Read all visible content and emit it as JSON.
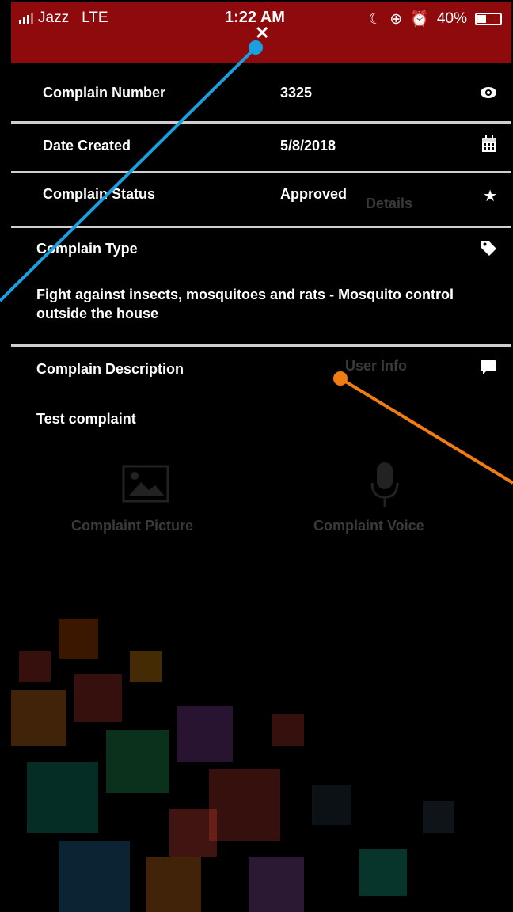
{
  "status": {
    "carrier": "Jazz",
    "network": "LTE",
    "time": "1:22 AM",
    "battery": "40%",
    "battery_level": 0.4
  },
  "close_label": "✕",
  "rows": {
    "number": {
      "label": "Complain Number",
      "value": "3325",
      "icon": "eye-icon"
    },
    "date": {
      "label": "Date Created",
      "value": "5/8/2018",
      "icon": "calendar-icon"
    },
    "status": {
      "label": "Complain Status",
      "value": "Approved",
      "icon": "star-icon"
    }
  },
  "type_section": {
    "label": "Complain Type",
    "text": "Fight against insects, mosquitoes and rats - Mosquito control outside the house",
    "icon": "tag-icon"
  },
  "description_section": {
    "label": "Complain Description",
    "text": "Test complaint",
    "icon": "comment-icon"
  },
  "underlay": {
    "details": "Details",
    "user_info": "User Info",
    "picture": "Complaint Picture",
    "voice": "Complaint Voice"
  },
  "colors": {
    "header": "#8e0a0d",
    "annotation_blue": "#1aa0e0",
    "annotation_orange": "#f07d12"
  }
}
